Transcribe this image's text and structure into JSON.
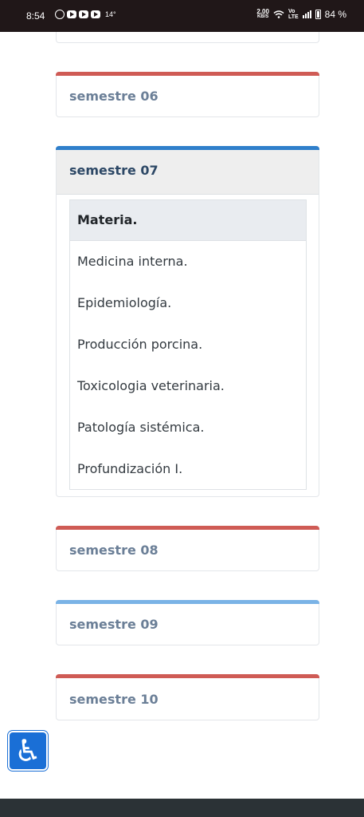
{
  "status_bar": {
    "time": "8:54",
    "temperature": "14°",
    "net_speed_value": "2.00",
    "net_speed_unit": "KB/S",
    "volte_top": "Vo",
    "volte_bottom": "LTE",
    "battery_pct": "84 %"
  },
  "semesters": [
    {
      "label": "semestre 06",
      "accent": "#cf5b55"
    },
    {
      "label": "semestre 07",
      "accent": "#2f7fcb"
    },
    {
      "label": "semestre 08",
      "accent": "#cf5b55"
    },
    {
      "label": "semestre 09",
      "accent": "#7ab3e6"
    },
    {
      "label": "semestre 10",
      "accent": "#cf5b55"
    }
  ],
  "table": {
    "header": "Materia.",
    "rows": [
      "Medicina interna.",
      "Epidemiología.",
      "Producción porcina.",
      "Toxicologia veterinaria.",
      "Patología sistémica.",
      "Profundización I."
    ]
  },
  "accessibility": {
    "icon": "wheelchair-icon",
    "glyph": "♿"
  }
}
